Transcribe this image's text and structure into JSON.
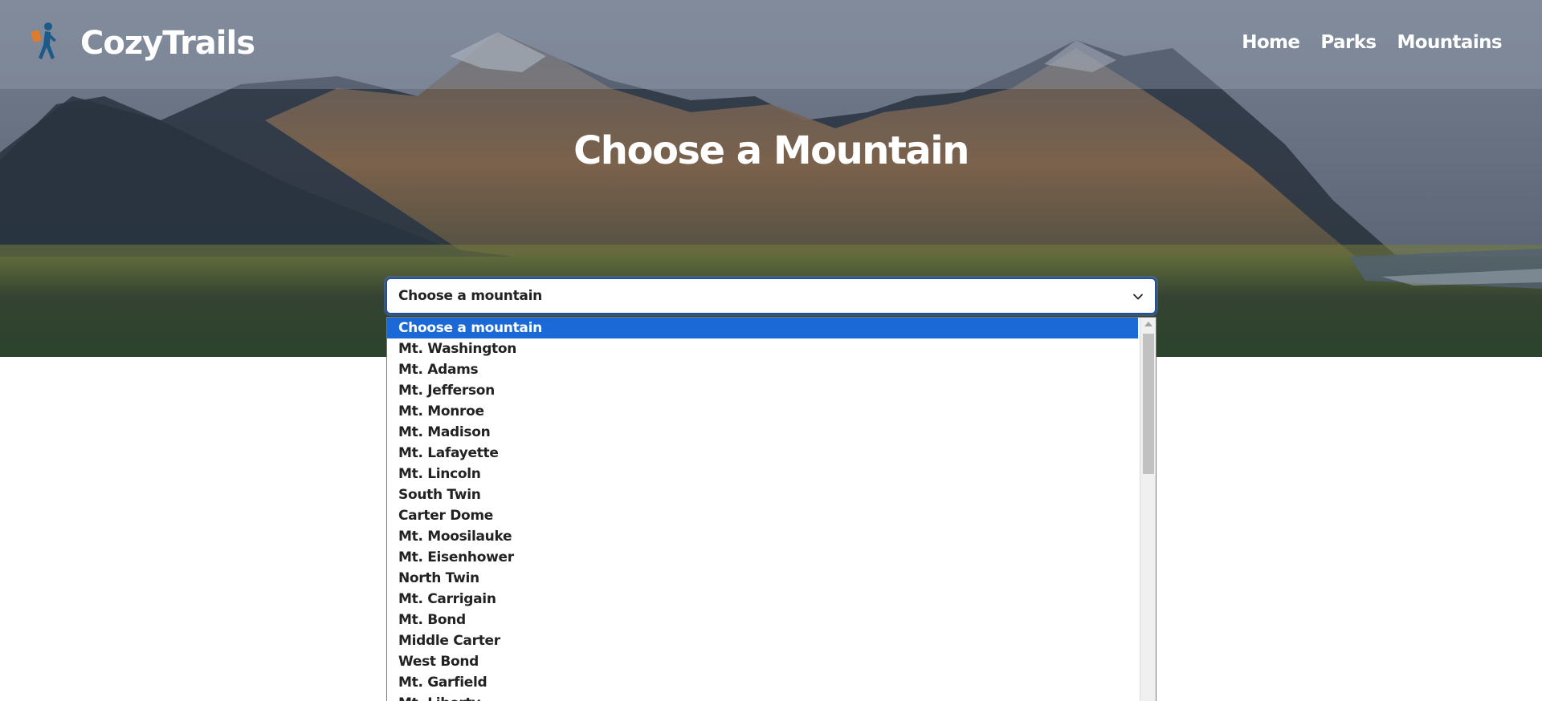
{
  "header": {
    "brand": "CozyTrails",
    "logo_icon": "hiker-icon",
    "nav": [
      "Home",
      "Parks",
      "Mountains"
    ]
  },
  "hero": {
    "title": "Choose a Mountain"
  },
  "mountain_select": {
    "value": "Choose a mountain",
    "chevron_icon": "chevron-down-icon",
    "options": [
      "Choose a mountain",
      "Mt. Washington",
      "Mt. Adams",
      "Mt. Jefferson",
      "Mt. Monroe",
      "Mt. Madison",
      "Mt. Lafayette",
      "Mt. Lincoln",
      "South Twin",
      "Carter Dome",
      "Mt. Moosilauke",
      "Mt. Eisenhower",
      "North Twin",
      "Mt. Carrigain",
      "Mt. Bond",
      "Middle Carter",
      "West Bond",
      "Mt. Garfield",
      "Mt. Liberty"
    ],
    "selected_index": 0
  },
  "colors": {
    "selected_option": "#1a69d6",
    "select_border": "#1f4fa8",
    "logo_orange": "#e07b2a",
    "logo_blue": "#1c5a8a"
  }
}
